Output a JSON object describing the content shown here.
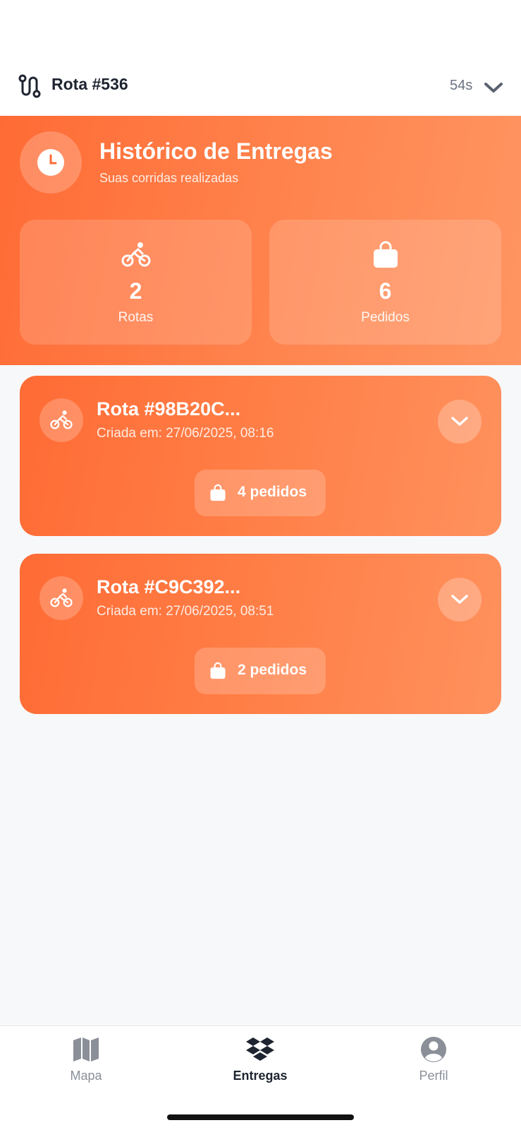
{
  "header": {
    "route_title": "Rota #536",
    "timer": "54s",
    "route_icon": "route-icon",
    "collapse_icon": "chevron-down-icon"
  },
  "hero": {
    "title": "Histórico de Entregas",
    "subtitle": "Suas corridas realizadas",
    "icon": "clock-icon",
    "stats": [
      {
        "icon": "bicycle-icon",
        "value": "2",
        "label": "Rotas"
      },
      {
        "icon": "shopping-bag-icon",
        "value": "6",
        "label": "Pedidos"
      }
    ]
  },
  "routes": [
    {
      "title": "Rota #98B20C...",
      "date": "Criada em: 27/06/2025, 08:16",
      "orders": "4 pedidos"
    },
    {
      "title": "Rota #C9C392...",
      "date": "Criada em: 27/06/2025, 08:51",
      "orders": "2 pedidos"
    }
  ],
  "nav": {
    "items": [
      {
        "label": "Mapa",
        "icon": "map-icon",
        "active": false
      },
      {
        "label": "Entregas",
        "icon": "dropbox-icon",
        "active": true
      },
      {
        "label": "Perfil",
        "icon": "user-circle-icon",
        "active": false
      }
    ]
  },
  "colors": {
    "accent": "#ff6b35",
    "accent_light": "#ff915d",
    "text_dark": "#1e2430",
    "nav_inactive": "#8a8f98"
  }
}
